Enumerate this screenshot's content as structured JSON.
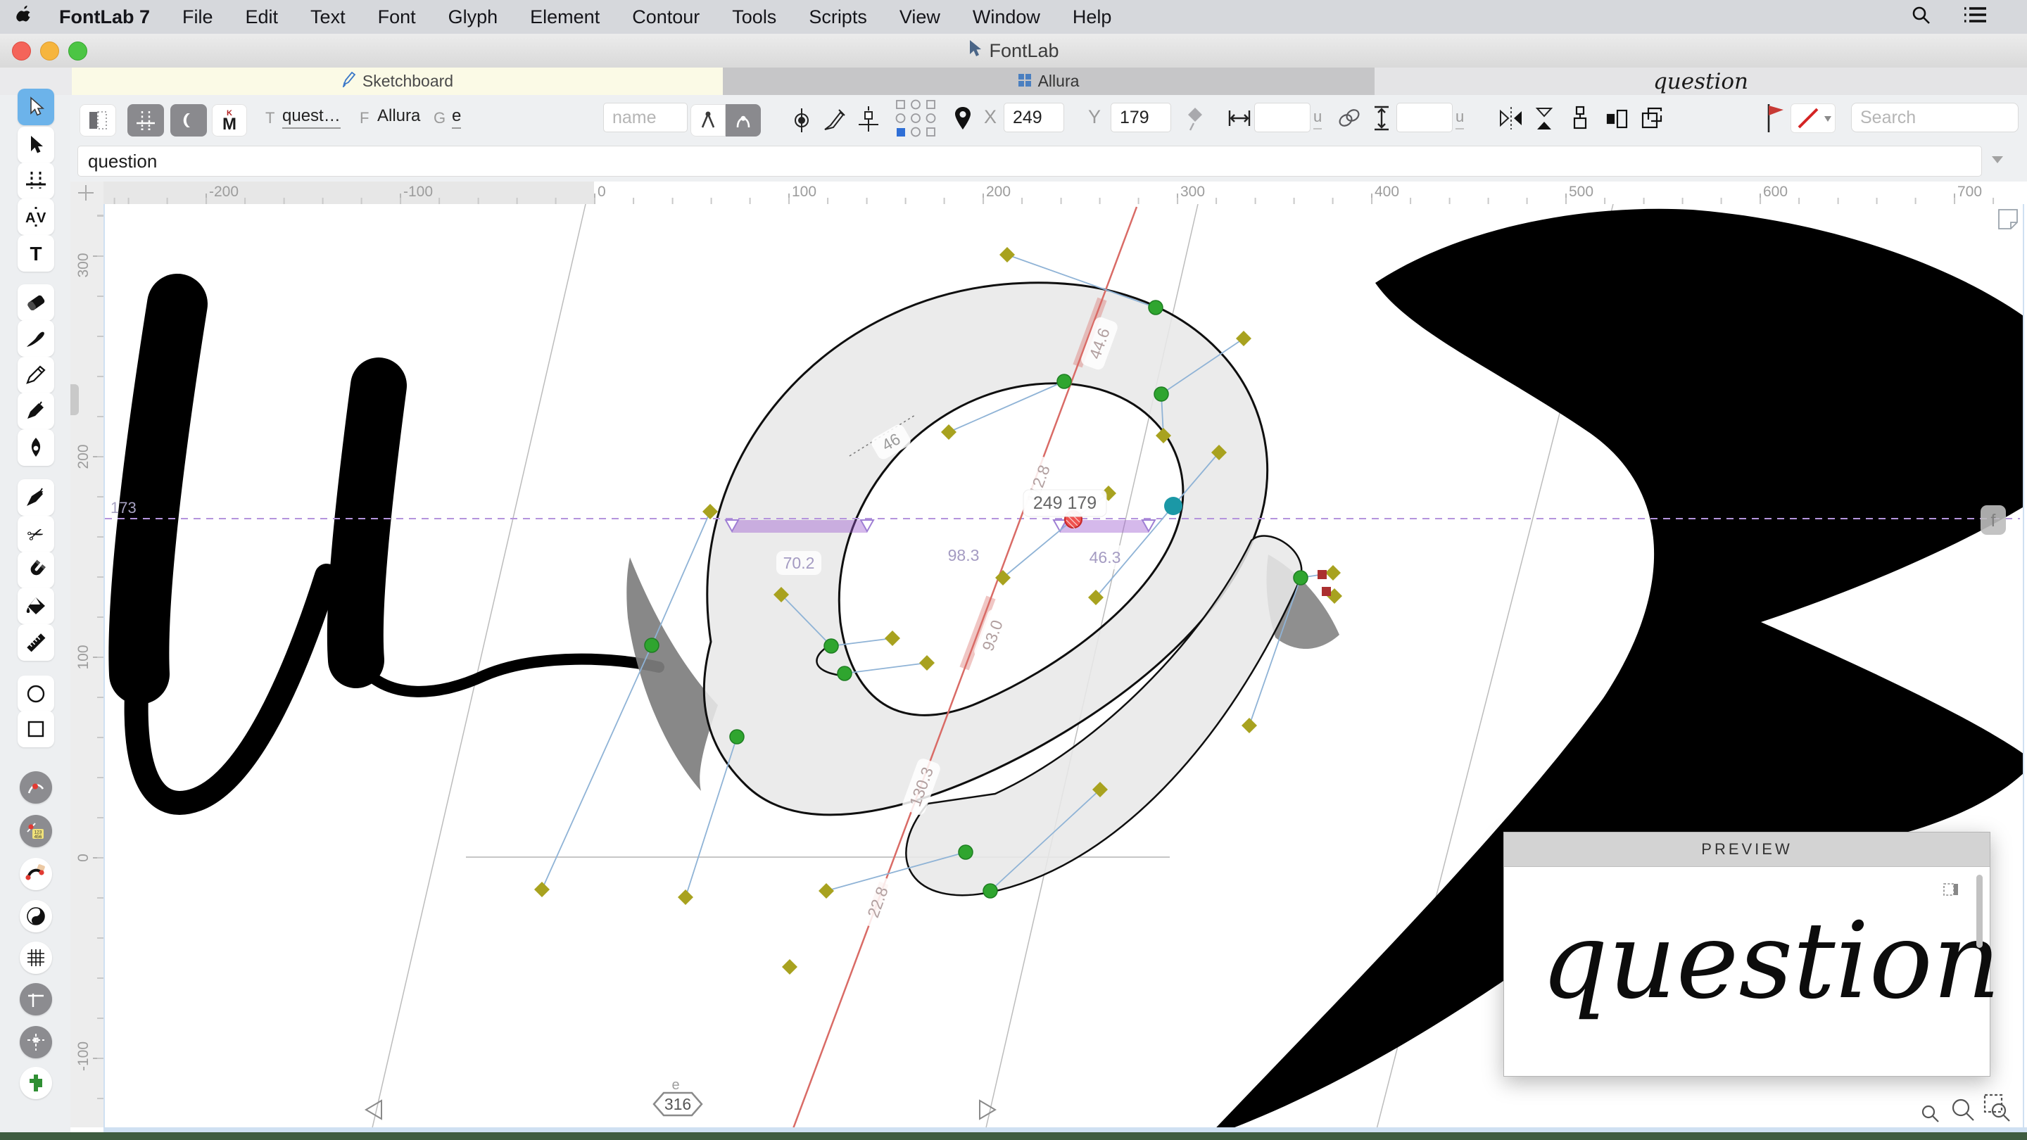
{
  "menubar": {
    "app": "FontLab 7",
    "items": [
      "File",
      "Edit",
      "Text",
      "Font",
      "Glyph",
      "Element",
      "Contour",
      "Tools",
      "Scripts",
      "View",
      "Window",
      "Help"
    ]
  },
  "window": {
    "title": "FontLab"
  },
  "tabs": {
    "sketchboard": "Sketchboard",
    "allura": "Allura",
    "sample_text": "question"
  },
  "toolbar": {
    "text_label": "T",
    "text_value": "quest…",
    "font_label": "F",
    "font_value": "Allura",
    "glyph_label": "G",
    "glyph_value": "e",
    "name_placeholder": "name",
    "x_label": "X",
    "x_value": "249",
    "y_label": "Y",
    "y_value": "179",
    "width_unit": "u",
    "height_unit": "u",
    "search_placeholder": "Search"
  },
  "glyph_bar": {
    "value": "question"
  },
  "rulers": {
    "top": [
      "-200",
      "-100",
      "0",
      "100",
      "200",
      "300",
      "400",
      "500",
      "600",
      "700"
    ],
    "left": [
      "300",
      "200",
      "100",
      "0",
      "-100"
    ]
  },
  "canvas": {
    "guide_value": "173",
    "guide_tag": "f",
    "coord_label": "249 179",
    "advance_width": "316",
    "glyph_name": "e",
    "measures": {
      "top": "44.6",
      "stroke": "46",
      "left_band": "70.2",
      "mid": "98.3",
      "right_band": "46.3",
      "diag_upper": "112.8",
      "diag_mid": "93.0",
      "diag_lower": "130.3",
      "diag_bottom": "22.8"
    }
  },
  "preview": {
    "title": "PREVIEW",
    "text": "question"
  },
  "colors": {
    "tab_active_bg": "#fbfae6",
    "selection_blue": "#6cb3ea",
    "node_green": "#2fa52f",
    "handle_olive": "#a8a21f",
    "guide_purple": "#9b59d0",
    "measure_red": "#d96b66",
    "node_teal": "#1b98a6",
    "selected_node_red": "#ef5350",
    "flag_red": "#c73a35",
    "dock_green": "#3e5c40"
  }
}
